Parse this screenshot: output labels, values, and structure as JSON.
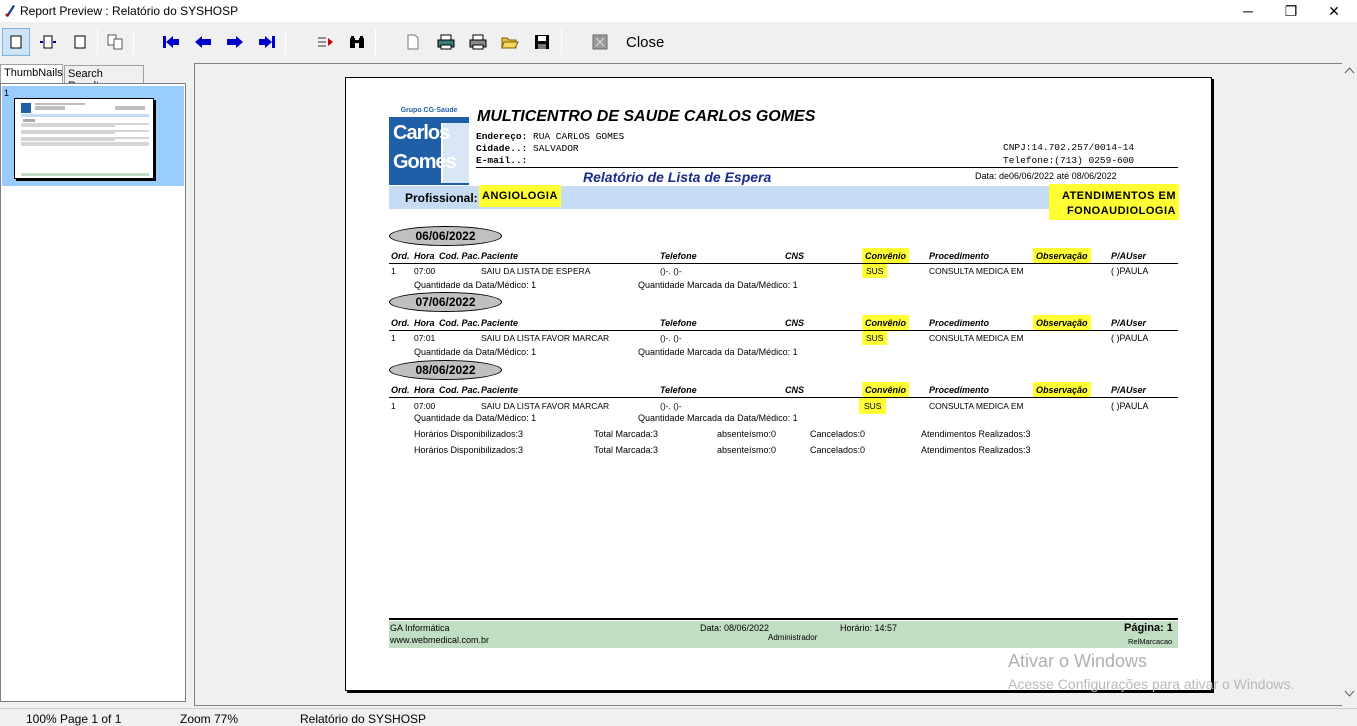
{
  "window": {
    "title": "Report Preview : Relatório do SYSHOSP",
    "minimize": "─",
    "maximize": "❐",
    "close": "✕"
  },
  "toolbar": {
    "close_label": "Close",
    "icons": [
      "page-view-icon",
      "page-width-icon",
      "full-page-icon",
      "multi-page-icon",
      "first-page-icon",
      "previous-page-icon",
      "next-page-icon",
      "last-page-icon",
      "goto-page-icon",
      "search-icon",
      "printer-setup-icon",
      "print-icon",
      "print-direct-icon",
      "open-icon",
      "save-icon",
      "export-icon"
    ]
  },
  "left_panel": {
    "tabs": [
      "ThumbNails",
      "Search Results"
    ],
    "thumb_number": "1"
  },
  "report": {
    "logo": {
      "top": "Grupo CG·Saúde",
      "line1": "Carlos",
      "line2": "Gomes"
    },
    "hospital": "MULTICENTRO DE SAUDE CARLOS GOMES",
    "endereco_label": "Endereço:",
    "endereco": "RUA CARLOS GOMES",
    "cidade_label": "Cidade..:",
    "cidade": "SALVADOR",
    "email_label": "E-mail..:",
    "cnpj": "CNPJ:14.702.257/0014-14",
    "telefone": "Telefone:(713) 0259-600",
    "title": "Relatório de Lista de Espera",
    "date_range": "Data: de06/06/2022   até 08/06/2022",
    "prof_label": "Profissional:",
    "prof_value": "ANGIOLOGIA",
    "atend_line1": "ATENDIMENTOS EM",
    "atend_line2": "FONOAUDIOLOGIA",
    "columns": {
      "ord": "Ord.",
      "hora": "Hora",
      "cod": "Cod. Pac.",
      "paciente": "Paciente",
      "telefone": "Telefone",
      "cns": "CNS",
      "convenio": "Convênio",
      "procedimento": "Procedimento",
      "observacao": "Observação",
      "pauser": "P/AUser"
    },
    "groups": [
      {
        "date": "06/06/2022",
        "ord": "1",
        "hora": "07:00",
        "paciente": "SAIU DA LISTA DE ESPERA",
        "tel": "()-. ()-",
        "conv": "SUS",
        "proc": "CONSULTA MEDICA EM",
        "user": "(   )PAULA",
        "qtd_data": "Quantidade da Data/Médico: 1",
        "qtd_marc": "Quantidade Marcada da Data/Médico: 1"
      },
      {
        "date": "07/06/2022",
        "ord": "1",
        "hora": "07:01",
        "paciente": "SAIU DA LISTA FAVOR MARCAR",
        "tel": "()-. ()-",
        "conv": "SUS",
        "proc": "CONSULTA MEDICA EM",
        "user": "(   )PAULA",
        "qtd_data": "Quantidade da Data/Médico: 1",
        "qtd_marc": "Quantidade Marcada da Data/Médico: 1"
      },
      {
        "date": "08/06/2022",
        "ord": "1",
        "hora": "07:00",
        "paciente": "SAIU DA LISTA FAVOR MARCAR",
        "tel": "()-. ()-",
        "conv": "SUS",
        "proc": "CONSULTA MEDICA EM",
        "user": "(   )PAULA",
        "qtd_data": "Quantidade da Data/Médico: 1",
        "qtd_marc": "Quantidade Marcada da Data/Médico: 1"
      }
    ],
    "summary": [
      {
        "disp": "Horários Disponibilizados:3",
        "marc": "Total Marcada:3",
        "abs": "absenteísmo:0",
        "canc": "Cancelados:0",
        "real": "Atendimentos Realizados:3"
      },
      {
        "disp": "Horários Disponibilizados:3",
        "marc": "Total Marcada:3",
        "abs": "absenteísmo:0",
        "canc": "Cancelados:0",
        "real": "Atendimentos Realizados:3"
      }
    ],
    "footer": {
      "company": "GA Informática",
      "site": "www.webmedical.com.br",
      "date": "Data: 08/06/2022",
      "user": "Administrador",
      "time": "Horário: 14:57",
      "page": "Página: 1",
      "form": "RelMarcacao"
    }
  },
  "watermark": {
    "line1": "Ativar o Windows",
    "line2": "Acesse Configurações para ativar o Windows."
  },
  "status": {
    "percent": "100%",
    "page": "Page 1 of 1",
    "zoom": "Zoom 77%",
    "report": "Relatório do SYSHOSP"
  }
}
